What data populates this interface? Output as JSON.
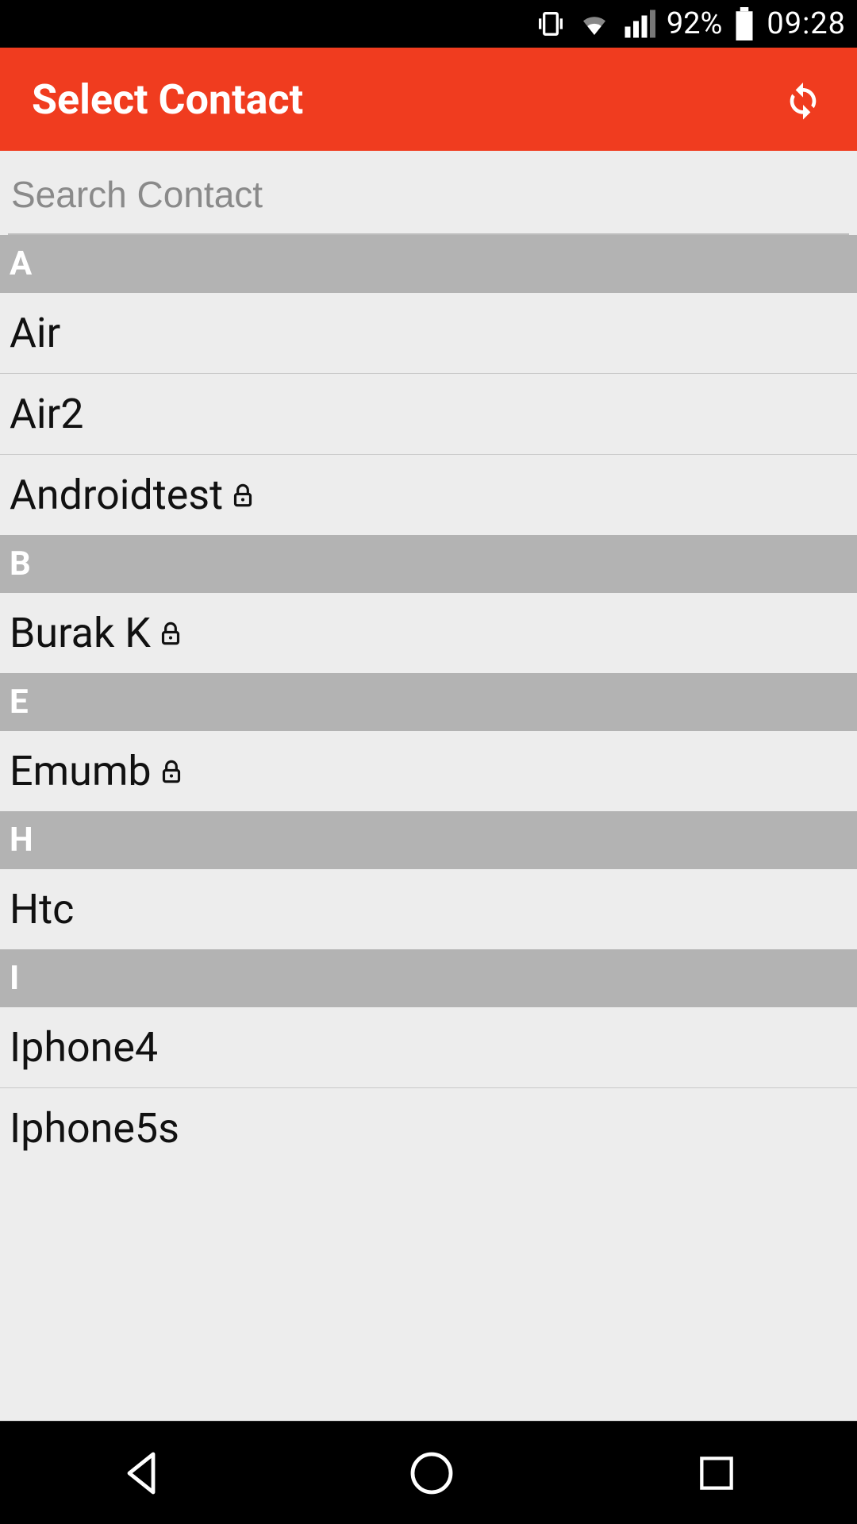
{
  "status": {
    "battery_pct": "92%",
    "time": "09:28"
  },
  "header": {
    "title": "Select Contact"
  },
  "search": {
    "placeholder": "Search Contact",
    "value": ""
  },
  "sections": [
    {
      "letter": "A",
      "contacts": [
        {
          "name": "Air",
          "locked": false
        },
        {
          "name": "Air2",
          "locked": false
        },
        {
          "name": "Androidtest",
          "locked": true
        }
      ]
    },
    {
      "letter": "B",
      "contacts": [
        {
          "name": "Burak K",
          "locked": true
        }
      ]
    },
    {
      "letter": "E",
      "contacts": [
        {
          "name": "Emumb",
          "locked": true
        }
      ]
    },
    {
      "letter": "H",
      "contacts": [
        {
          "name": "Htc",
          "locked": false
        }
      ]
    },
    {
      "letter": "I",
      "contacts": [
        {
          "name": "Iphone4",
          "locked": false
        },
        {
          "name": "Iphone5s",
          "locked": false
        }
      ]
    }
  ],
  "colors": {
    "accent": "#f03c1f",
    "section_header_bg": "#b3b3b3",
    "page_bg": "#ededed"
  }
}
